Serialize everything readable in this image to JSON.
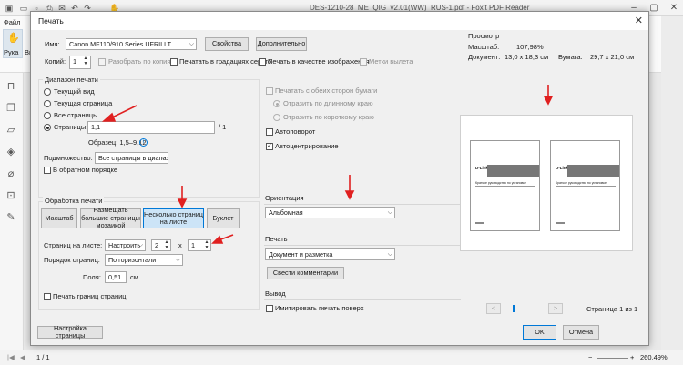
{
  "app": {
    "title": "DES-1210-28_ME_QIG_v2.01(WW)_RUS-1.pdf - Foxit PDF Reader",
    "menu_file": "Файл",
    "tool_hand": "Рука",
    "tool_select": "Выб",
    "page_indicator": "1 / 1",
    "zoom": "260,49%"
  },
  "dialog": {
    "title": "Печать",
    "printer": {
      "label": "Имя:",
      "value": "Canon MF110/910 Series UFRII LT",
      "properties_button": "Свойства",
      "advanced_button": "Дополнительно"
    },
    "copies": {
      "label": "Копий:",
      "value": "1",
      "collate": "Разобрать по копиям",
      "grayscale": "Печатать в градациях серого",
      "as_image": "Печать в качестве изображения",
      "crop_marks": "Метки вылета"
    },
    "range": {
      "title": "Диапазон печати",
      "current_view": "Текущий вид",
      "current_page": "Текущая страница",
      "all_pages": "Все страницы",
      "pages_label": "Страницы:",
      "pages_value": "1,1",
      "pages_total": "/ 1",
      "example": "Образец: 1,5–9,12",
      "subset_label": "Подмножество:",
      "subset_value": "Все страницы в диапаз",
      "reverse": "В обратном порядке"
    },
    "duplex": {
      "both_sides": "Печатать с обеих сторон бумаги",
      "long_edge": "Отразить по длинному краю",
      "short_edge": "Отразить по короткому краю",
      "autorotate": "Автоповорот",
      "autocenter": "Автоцентрирование"
    },
    "handling": {
      "title": "Обработка печати",
      "scale": "Масштаб",
      "poster": "Размещать большие страницы мозаикой",
      "multiple": "Несколько страниц на листе",
      "booklet": "Буклет",
      "per_sheet_label": "Страниц на листе:",
      "per_sheet_value": "Настроить",
      "cols_value": "2",
      "by": "x",
      "rows_value": "1",
      "order_label": "Порядок страниц:",
      "order_value": "По горизонтали",
      "margins_label": "Поля:",
      "margins_value": "0,51",
      "margins_unit": "см",
      "borders": "Печать границ страниц"
    },
    "orientation": {
      "title": "Ориентация",
      "value": "Альбомная"
    },
    "print_what": {
      "title": "Печать",
      "value": "Документ и разметка",
      "summarize_button": "Свести комментарии"
    },
    "output": {
      "title": "Вывод",
      "simulate_overprint": "Имитировать печать поверх"
    },
    "preview": {
      "title": "Просмотр",
      "scale_label": "Масштаб:",
      "scale_value": "107,98%",
      "document_label": "Документ:",
      "document_value": "13,0 x 18,3 см",
      "paper_label": "Бумага:",
      "paper_value": "29,7 x 21,0 см",
      "page_brand": "D-Link",
      "page_caption": "Краткое руководство по установке",
      "prev_button": "<",
      "next_button": ">",
      "page_status": "Страница 1 из 1"
    },
    "page_setup_button": "Настройка страницы",
    "ok_button": "OK",
    "cancel_button": "Отмена"
  },
  "colors": {
    "accent": "#0078d7",
    "annotation_arrow": "#e02020"
  }
}
